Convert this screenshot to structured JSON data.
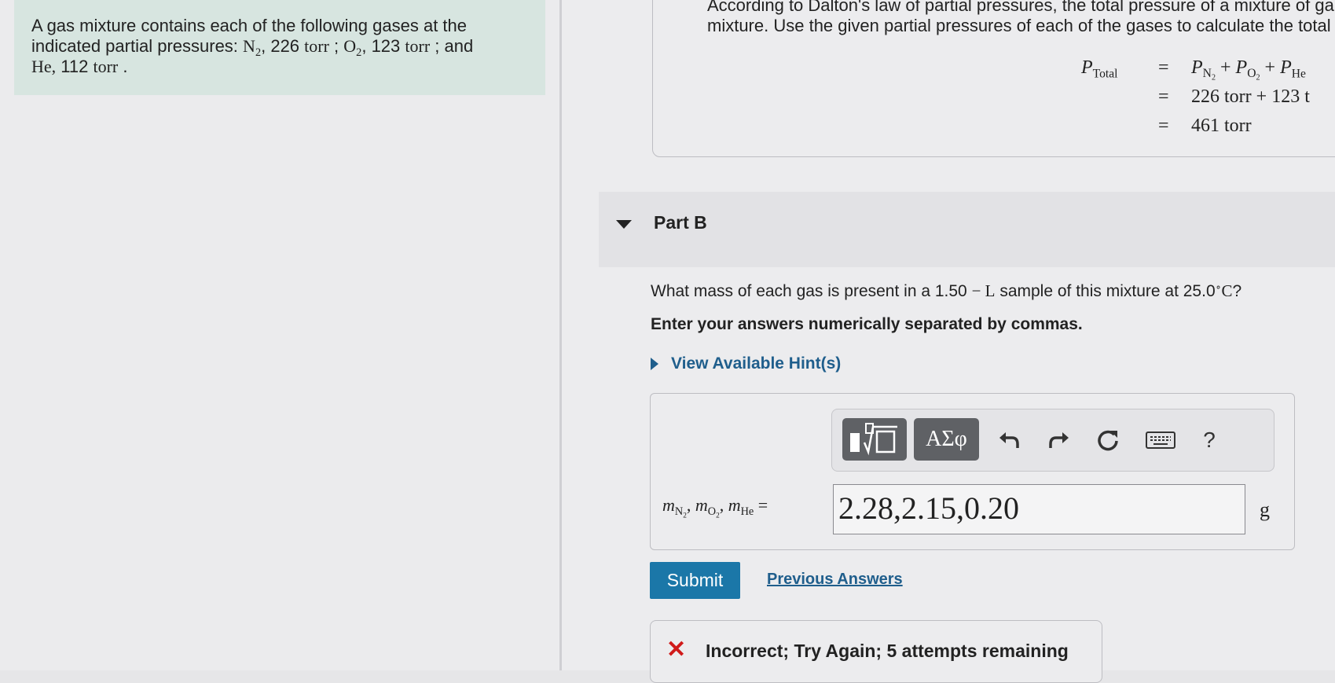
{
  "problem": {
    "line1": "A gas mixture contains each of the following gases at the",
    "line2_prefix": "indicated partial pressures:",
    "n2_pressure": "226",
    "o2_pressure": "123",
    "he_pressure": "112",
    "unit": "torr",
    "and": "and",
    "he_label": "He,"
  },
  "explanation": {
    "line1": "According to Dalton's law of partial pressures, the total pressure of a mixture of ga",
    "line2": "mixture. Use the given partial pressures of each of the gases to calculate the total",
    "eq_row2": "226 torr + 123 t",
    "eq_row3": "461 torr"
  },
  "part_b": {
    "title": "Part B",
    "question_prefix": "What mass of each gas is present in a 1.50",
    "question_mid": "sample of this mixture at 25.0",
    "question_end": "?",
    "instruction": "Enter your answers numerically separated by commas.",
    "hint_link": "View Available Hint(s)"
  },
  "toolbar": {
    "symbols_label": "ΑΣφ",
    "help_label": "?"
  },
  "answer": {
    "value": "2.28,2.15,0.20",
    "unit": "g"
  },
  "actions": {
    "submit_label": "Submit",
    "previous_answers_label": "Previous Answers"
  },
  "feedback": {
    "icon": "✕",
    "text": "Incorrect; Try Again; 5 attempts remaining"
  },
  "colors": {
    "problem_bg": "#d7e5e0",
    "link_blue": "#1f5e8c",
    "submit_blue": "#1b77a8",
    "error_red": "#d01a1a"
  },
  "icons": [
    "templates-icon",
    "symbols-icon",
    "undo-icon",
    "redo-icon",
    "reset-icon",
    "keyboard-icon",
    "help-icon",
    "close-icon",
    "caret-down-icon",
    "caret-right-icon"
  ]
}
